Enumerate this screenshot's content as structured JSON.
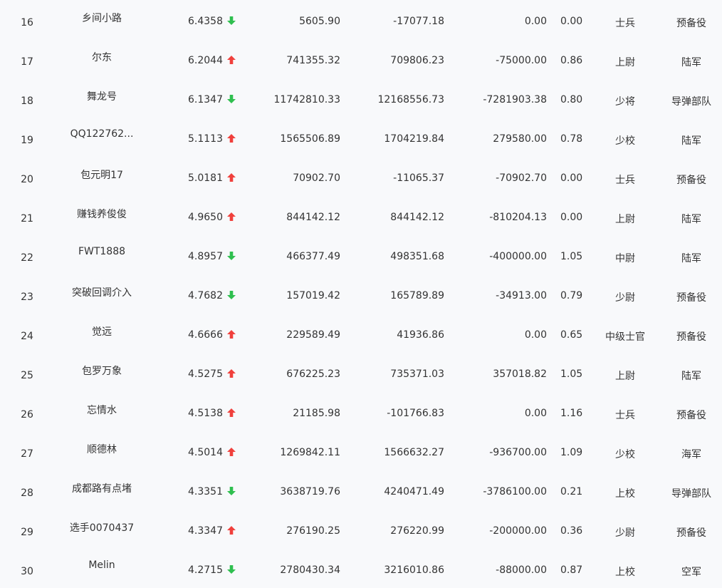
{
  "colors": {
    "up": "#f0403c",
    "down": "#2fbf4f",
    "text": "#333333",
    "background": "#f8f9fb"
  },
  "rows": [
    {
      "rank": "16",
      "name": "乡间小路",
      "score": "6.4358",
      "trend": "down",
      "v1": "5605.90",
      "v2": "-17077.18",
      "v3": "0.00",
      "ratio": "0.00",
      "title": "士兵",
      "branch": "预备役"
    },
    {
      "rank": "17",
      "name": "尔东",
      "score": "6.2044",
      "trend": "up",
      "v1": "741355.32",
      "v2": "709806.23",
      "v3": "-75000.00",
      "ratio": "0.86",
      "title": "上尉",
      "branch": "陆军"
    },
    {
      "rank": "18",
      "name": "舞龙号",
      "score": "6.1347",
      "trend": "down",
      "v1": "11742810.33",
      "v2": "12168556.73",
      "v3": "-7281903.38",
      "ratio": "0.80",
      "title": "少将",
      "branch": "导弹部队"
    },
    {
      "rank": "19",
      "name": "QQ122762...",
      "score": "5.1113",
      "trend": "up",
      "v1": "1565506.89",
      "v2": "1704219.84",
      "v3": "279580.00",
      "ratio": "0.78",
      "title": "少校",
      "branch": "陆军"
    },
    {
      "rank": "20",
      "name": "包元明17",
      "score": "5.0181",
      "trend": "up",
      "v1": "70902.70",
      "v2": "-11065.37",
      "v3": "-70902.70",
      "ratio": "0.00",
      "title": "士兵",
      "branch": "预备役"
    },
    {
      "rank": "21",
      "name": "赚钱养俊俊",
      "score": "4.9650",
      "trend": "up",
      "v1": "844142.12",
      "v2": "844142.12",
      "v3": "-810204.13",
      "ratio": "0.00",
      "title": "上尉",
      "branch": "陆军"
    },
    {
      "rank": "22",
      "name": "FWT1888",
      "score": "4.8957",
      "trend": "down",
      "v1": "466377.49",
      "v2": "498351.68",
      "v3": "-400000.00",
      "ratio": "1.05",
      "title": "中尉",
      "branch": "陆军"
    },
    {
      "rank": "23",
      "name": "突破回调介入",
      "score": "4.7682",
      "trend": "down",
      "v1": "157019.42",
      "v2": "165789.89",
      "v3": "-34913.00",
      "ratio": "0.79",
      "title": "少尉",
      "branch": "预备役"
    },
    {
      "rank": "24",
      "name": "觉远",
      "score": "4.6666",
      "trend": "up",
      "v1": "229589.49",
      "v2": "41936.86",
      "v3": "0.00",
      "ratio": "0.65",
      "title": "中级士官",
      "branch": "预备役"
    },
    {
      "rank": "25",
      "name": "包罗万象",
      "score": "4.5275",
      "trend": "up",
      "v1": "676225.23",
      "v2": "735371.03",
      "v3": "357018.82",
      "ratio": "1.05",
      "title": "上尉",
      "branch": "陆军"
    },
    {
      "rank": "26",
      "name": "忘情水",
      "score": "4.5138",
      "trend": "up",
      "v1": "21185.98",
      "v2": "-101766.83",
      "v3": "0.00",
      "ratio": "1.16",
      "title": "士兵",
      "branch": "预备役"
    },
    {
      "rank": "27",
      "name": "顺德林",
      "score": "4.5014",
      "trend": "up",
      "v1": "1269842.11",
      "v2": "1566632.27",
      "v3": "-936700.00",
      "ratio": "1.09",
      "title": "少校",
      "branch": "海军"
    },
    {
      "rank": "28",
      "name": "成都路有点堵",
      "score": "4.3351",
      "trend": "down",
      "v1": "3638719.76",
      "v2": "4240471.49",
      "v3": "-3786100.00",
      "ratio": "0.21",
      "title": "上校",
      "branch": "导弹部队"
    },
    {
      "rank": "29",
      "name": "选手0070437",
      "score": "4.3347",
      "trend": "up",
      "v1": "276190.25",
      "v2": "276220.99",
      "v3": "-200000.00",
      "ratio": "0.36",
      "title": "少尉",
      "branch": "预备役"
    },
    {
      "rank": "30",
      "name": "Melin",
      "score": "4.2715",
      "trend": "down",
      "v1": "2780430.34",
      "v2": "3216010.86",
      "v3": "-88000.00",
      "ratio": "0.87",
      "title": "上校",
      "branch": "空军"
    }
  ]
}
